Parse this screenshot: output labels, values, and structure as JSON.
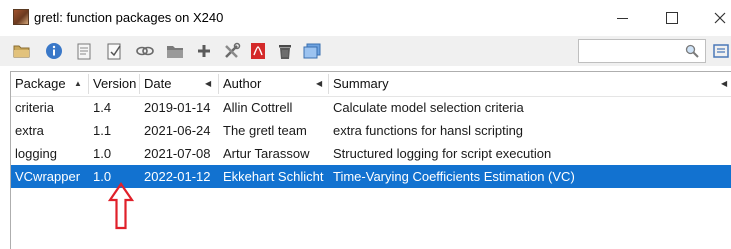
{
  "window": {
    "title": "gretl: function packages on X240",
    "icon": "gretl-app-icon",
    "controls": [
      "minimize-icon",
      "maximize-icon",
      "close-icon"
    ]
  },
  "toolbar": {
    "buttons": [
      {
        "name": "open-folder-icon"
      },
      {
        "name": "info-icon"
      },
      {
        "name": "view-code-icon"
      },
      {
        "name": "edit-package-icon"
      },
      {
        "name": "link-icon"
      },
      {
        "name": "folder-icon"
      },
      {
        "name": "add-icon"
      },
      {
        "name": "tools-icon"
      },
      {
        "name": "pdf-icon"
      },
      {
        "name": "delete-icon"
      },
      {
        "name": "window-icon"
      }
    ],
    "search": {
      "value": "",
      "placeholder": ""
    }
  },
  "table": {
    "columns": [
      {
        "label": "Package",
        "sort": "ascending"
      },
      {
        "label": "Version",
        "sort": ""
      },
      {
        "label": "Date",
        "sort": "menu"
      },
      {
        "label": "Author",
        "sort": "menu"
      },
      {
        "label": "Summary",
        "sort": "menu"
      }
    ],
    "rows": [
      {
        "package": "criteria",
        "version": "1.4",
        "date": "2019-01-14",
        "author": "Allin Cottrell",
        "summary": "Calculate model selection criteria",
        "selected": false
      },
      {
        "package": "extra",
        "version": "1.1",
        "date": "2021-06-24",
        "author": "The gretl team",
        "summary": "extra functions for hansl scripting",
        "selected": false
      },
      {
        "package": "logging",
        "version": "1.0",
        "date": "2021-07-08",
        "author": "Artur Tarassow",
        "summary": "Structured logging for script execution",
        "selected": false
      },
      {
        "package": "VCwrapper",
        "version": "1.0",
        "date": "2022-01-12",
        "author": "Ekkehart Schlicht",
        "summary": "Time-Varying Coefficients Estimation (VC)",
        "selected": true
      }
    ]
  },
  "colors": {
    "selection": "#1272d0",
    "annotation_arrow": "#e0202a",
    "toolbar_bg": "#f0f0f0"
  }
}
